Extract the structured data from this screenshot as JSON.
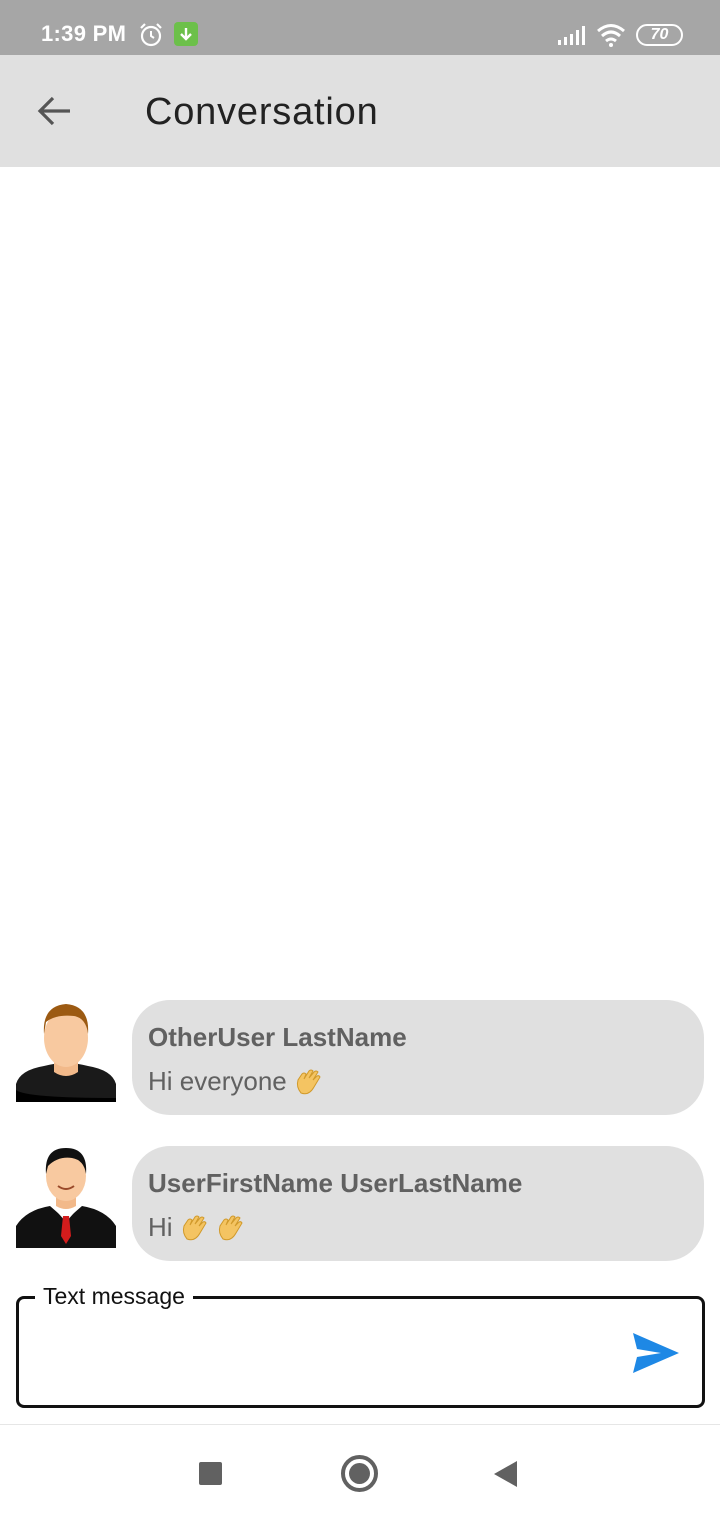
{
  "status_bar": {
    "time": "1:39 PM",
    "battery": "70",
    "icons": [
      "alarm-icon",
      "download-icon",
      "signal-icon",
      "wifi-icon",
      "battery-icon"
    ]
  },
  "app_bar": {
    "title": "Conversation",
    "back_icon": "arrow-left-icon"
  },
  "messages": [
    {
      "sender": "OtherUser LastName",
      "text": "Hi everyone",
      "emoji": [
        "waving-hand"
      ]
    },
    {
      "sender": "UserFirstName UserLastName",
      "text": "Hi",
      "emoji": [
        "waving-hand",
        "waving-hand"
      ]
    }
  ],
  "composer": {
    "label": "Text message",
    "value": "",
    "send_icon": "send-icon",
    "accent_color": "#1e88e5"
  },
  "nav_bar": {
    "icons": [
      "recents-icon",
      "home-icon",
      "back-icon"
    ]
  }
}
